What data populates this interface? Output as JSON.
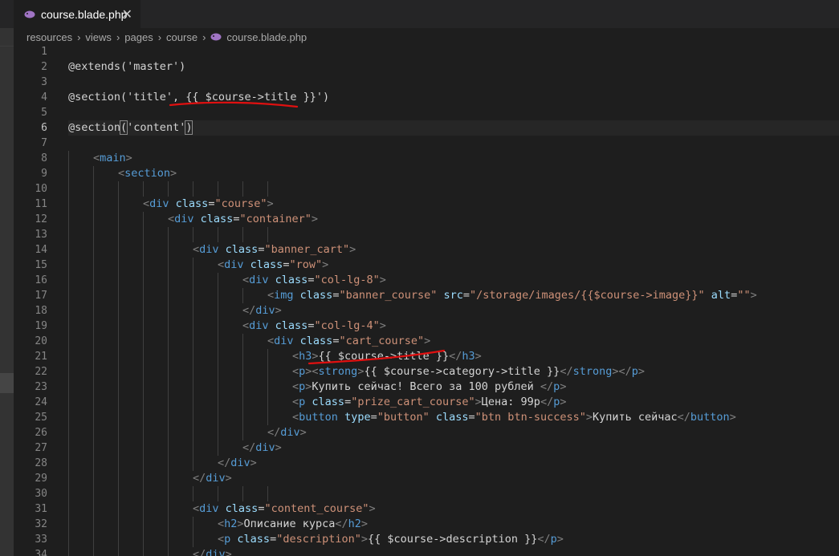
{
  "tab": {
    "filename": "course.blade.php",
    "icon": "php-elephant-icon",
    "close_glyph": "✕"
  },
  "breadcrumb": [
    "resources",
    "views",
    "pages",
    "course",
    "course.blade.php"
  ],
  "editor": {
    "active_line": 6,
    "lines": [
      {
        "n": "1",
        "indent": 0,
        "tokens": []
      },
      {
        "n": "2",
        "indent": 0,
        "tokens": [
          [
            "tx",
            "@extends('master')"
          ]
        ]
      },
      {
        "n": "3",
        "indent": 0,
        "tokens": []
      },
      {
        "n": "4",
        "indent": 0,
        "tokens": [
          [
            "tx",
            "@section('title', {{ $course->title }}')"
          ]
        ]
      },
      {
        "n": "5",
        "indent": 0,
        "tokens": []
      },
      {
        "n": "6",
        "indent": 0,
        "tokens": [
          [
            "tx",
            "@section"
          ],
          [
            "bracket",
            "("
          ],
          [
            "tx",
            "'content'"
          ],
          [
            "bracket",
            ")"
          ]
        ]
      },
      {
        "n": "7",
        "indent": 0,
        "tokens": []
      },
      {
        "n": "8",
        "indent": 1,
        "tokens": [
          [
            "tag",
            "<"
          ],
          [
            "tn",
            "main"
          ],
          [
            "tag",
            ">"
          ]
        ]
      },
      {
        "n": "9",
        "indent": 2,
        "tokens": [
          [
            "tag",
            "<"
          ],
          [
            "tn",
            "section"
          ],
          [
            "tag",
            ">"
          ]
        ]
      },
      {
        "n": "10",
        "indent": 0,
        "tokens": []
      },
      {
        "n": "11",
        "indent": 3,
        "tokens": [
          [
            "tag",
            "<"
          ],
          [
            "tn",
            "div"
          ],
          [
            "tx",
            " "
          ],
          [
            "at",
            "class"
          ],
          [
            "tx",
            "="
          ],
          [
            "st",
            "\"course\""
          ],
          [
            "tag",
            ">"
          ]
        ]
      },
      {
        "n": "12",
        "indent": 4,
        "tokens": [
          [
            "tag",
            "<"
          ],
          [
            "tn",
            "div"
          ],
          [
            "tx",
            " "
          ],
          [
            "at",
            "class"
          ],
          [
            "tx",
            "="
          ],
          [
            "st",
            "\"container\""
          ],
          [
            "tag",
            ">"
          ]
        ]
      },
      {
        "n": "13",
        "indent": 0,
        "tokens": []
      },
      {
        "n": "14",
        "indent": 5,
        "tokens": [
          [
            "tag",
            "<"
          ],
          [
            "tn",
            "div"
          ],
          [
            "tx",
            " "
          ],
          [
            "at",
            "class"
          ],
          [
            "tx",
            "="
          ],
          [
            "st",
            "\"banner_cart\""
          ],
          [
            "tag",
            ">"
          ]
        ]
      },
      {
        "n": "15",
        "indent": 6,
        "tokens": [
          [
            "tag",
            "<"
          ],
          [
            "tn",
            "div"
          ],
          [
            "tx",
            " "
          ],
          [
            "at",
            "class"
          ],
          [
            "tx",
            "="
          ],
          [
            "st",
            "\"row\""
          ],
          [
            "tag",
            ">"
          ]
        ]
      },
      {
        "n": "16",
        "indent": 7,
        "tokens": [
          [
            "tag",
            "<"
          ],
          [
            "tn",
            "div"
          ],
          [
            "tx",
            " "
          ],
          [
            "at",
            "class"
          ],
          [
            "tx",
            "="
          ],
          [
            "st",
            "\"col-lg-8\""
          ],
          [
            "tag",
            ">"
          ]
        ]
      },
      {
        "n": "17",
        "indent": 8,
        "tokens": [
          [
            "tag",
            "<"
          ],
          [
            "tn",
            "img"
          ],
          [
            "tx",
            " "
          ],
          [
            "at",
            "class"
          ],
          [
            "tx",
            "="
          ],
          [
            "st",
            "\"banner_course\""
          ],
          [
            "tx",
            " "
          ],
          [
            "at",
            "src"
          ],
          [
            "tx",
            "="
          ],
          [
            "st",
            "\"/storage/images/{{$course->image}}\""
          ],
          [
            "tx",
            " "
          ],
          [
            "at",
            "alt"
          ],
          [
            "tx",
            "="
          ],
          [
            "st",
            "\"\""
          ],
          [
            "tag",
            ">"
          ]
        ]
      },
      {
        "n": "18",
        "indent": 7,
        "tokens": [
          [
            "tag",
            "</"
          ],
          [
            "tn",
            "div"
          ],
          [
            "tag",
            ">"
          ]
        ]
      },
      {
        "n": "19",
        "indent": 7,
        "tokens": [
          [
            "tag",
            "<"
          ],
          [
            "tn",
            "div"
          ],
          [
            "tx",
            " "
          ],
          [
            "at",
            "class"
          ],
          [
            "tx",
            "="
          ],
          [
            "st",
            "\"col-lg-4\""
          ],
          [
            "tag",
            ">"
          ]
        ]
      },
      {
        "n": "20",
        "indent": 8,
        "tokens": [
          [
            "tag",
            "<"
          ],
          [
            "tn",
            "div"
          ],
          [
            "tx",
            " "
          ],
          [
            "at",
            "class"
          ],
          [
            "tx",
            "="
          ],
          [
            "st",
            "\"cart_course\""
          ],
          [
            "tag",
            ">"
          ]
        ]
      },
      {
        "n": "21",
        "indent": 9,
        "tokens": [
          [
            "tag",
            "<"
          ],
          [
            "tn",
            "h3"
          ],
          [
            "tag",
            ">"
          ],
          [
            "tx",
            "{{ $course->title }}"
          ],
          [
            "tag",
            "</"
          ],
          [
            "tn",
            "h3"
          ],
          [
            "tag",
            ">"
          ]
        ]
      },
      {
        "n": "22",
        "indent": 9,
        "tokens": [
          [
            "tag",
            "<"
          ],
          [
            "tn",
            "p"
          ],
          [
            "tag",
            "><"
          ],
          [
            "tn",
            "strong"
          ],
          [
            "tag",
            ">"
          ],
          [
            "tx",
            "{{ $course->category->title }}"
          ],
          [
            "tag",
            "</"
          ],
          [
            "tn",
            "strong"
          ],
          [
            "tag",
            "></"
          ],
          [
            "tn",
            "p"
          ],
          [
            "tag",
            ">"
          ]
        ]
      },
      {
        "n": "23",
        "indent": 9,
        "tokens": [
          [
            "tag",
            "<"
          ],
          [
            "tn",
            "p"
          ],
          [
            "tag",
            ">"
          ],
          [
            "tx",
            "Купить сейчас! Всего за 100 рублей "
          ],
          [
            "tag",
            "</"
          ],
          [
            "tn",
            "p"
          ],
          [
            "tag",
            ">"
          ]
        ]
      },
      {
        "n": "24",
        "indent": 9,
        "tokens": [
          [
            "tag",
            "<"
          ],
          [
            "tn",
            "p"
          ],
          [
            "tx",
            " "
          ],
          [
            "at",
            "class"
          ],
          [
            "tx",
            "="
          ],
          [
            "st",
            "\"prize_cart_course\""
          ],
          [
            "tag",
            ">"
          ],
          [
            "tx",
            "Цена: 99р"
          ],
          [
            "tag",
            "</"
          ],
          [
            "tn",
            "p"
          ],
          [
            "tag",
            ">"
          ]
        ]
      },
      {
        "n": "25",
        "indent": 9,
        "tokens": [
          [
            "tag",
            "<"
          ],
          [
            "tn",
            "button"
          ],
          [
            "tx",
            " "
          ],
          [
            "at",
            "type"
          ],
          [
            "tx",
            "="
          ],
          [
            "st",
            "\"button\""
          ],
          [
            "tx",
            " "
          ],
          [
            "at",
            "class"
          ],
          [
            "tx",
            "="
          ],
          [
            "st",
            "\"btn btn-success\""
          ],
          [
            "tag",
            ">"
          ],
          [
            "tx",
            "Купить сейчас"
          ],
          [
            "tag",
            "</"
          ],
          [
            "tn",
            "button"
          ],
          [
            "tag",
            ">"
          ]
        ]
      },
      {
        "n": "26",
        "indent": 8,
        "tokens": [
          [
            "tag",
            "</"
          ],
          [
            "tn",
            "div"
          ],
          [
            "tag",
            ">"
          ]
        ]
      },
      {
        "n": "27",
        "indent": 7,
        "tokens": [
          [
            "tag",
            "</"
          ],
          [
            "tn",
            "div"
          ],
          [
            "tag",
            ">"
          ]
        ]
      },
      {
        "n": "28",
        "indent": 6,
        "tokens": [
          [
            "tag",
            "</"
          ],
          [
            "tn",
            "div"
          ],
          [
            "tag",
            ">"
          ]
        ]
      },
      {
        "n": "29",
        "indent": 5,
        "tokens": [
          [
            "tag",
            "</"
          ],
          [
            "tn",
            "div"
          ],
          [
            "tag",
            ">"
          ]
        ]
      },
      {
        "n": "30",
        "indent": 0,
        "tokens": []
      },
      {
        "n": "31",
        "indent": 5,
        "tokens": [
          [
            "tag",
            "<"
          ],
          [
            "tn",
            "div"
          ],
          [
            "tx",
            " "
          ],
          [
            "at",
            "class"
          ],
          [
            "tx",
            "="
          ],
          [
            "st",
            "\"content_course\""
          ],
          [
            "tag",
            ">"
          ]
        ]
      },
      {
        "n": "32",
        "indent": 6,
        "tokens": [
          [
            "tag",
            "<"
          ],
          [
            "tn",
            "h2"
          ],
          [
            "tag",
            ">"
          ],
          [
            "tx",
            "Описание курса"
          ],
          [
            "tag",
            "</"
          ],
          [
            "tn",
            "h2"
          ],
          [
            "tag",
            ">"
          ]
        ]
      },
      {
        "n": "33",
        "indent": 6,
        "tokens": [
          [
            "tag",
            "<"
          ],
          [
            "tn",
            "p"
          ],
          [
            "tx",
            " "
          ],
          [
            "at",
            "class"
          ],
          [
            "tx",
            "="
          ],
          [
            "st",
            "\"description\""
          ],
          [
            "tag",
            ">"
          ],
          [
            "tx",
            "{{ $course->description }}"
          ],
          [
            "tag",
            "</"
          ],
          [
            "tn",
            "p"
          ],
          [
            "tag",
            ">"
          ]
        ]
      },
      {
        "n": "34",
        "indent": 5,
        "tokens": [
          [
            "tag",
            "</"
          ],
          [
            "tn",
            "div"
          ],
          [
            "tag",
            ">"
          ]
        ]
      }
    ]
  },
  "annotations": {
    "underline_color": "#e01010"
  }
}
